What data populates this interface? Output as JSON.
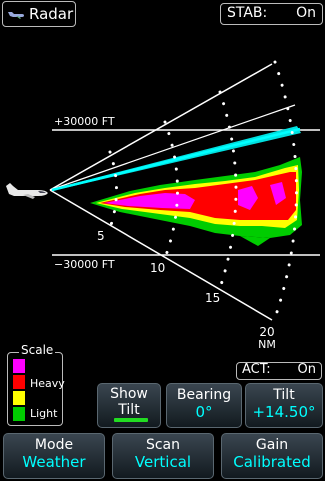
{
  "header": {
    "title": "Radar",
    "stab_label": "STAB:",
    "stab_value": "On"
  },
  "radar": {
    "alt_upper_label": "+30000 FT",
    "alt_lower_label": "−30000 FT",
    "range_labels": [
      "5",
      "10",
      "15",
      "20"
    ],
    "range_unit": "NM"
  },
  "scale": {
    "title": "Scale",
    "levels": [
      {
        "color": "#ff00ff",
        "label": ""
      },
      {
        "color": "#ff0000",
        "label": "Heavy"
      },
      {
        "color": "#ffff00",
        "label": ""
      },
      {
        "color": "#00cc00",
        "label": "Light"
      }
    ]
  },
  "act": {
    "label": "ACT:",
    "value": "On"
  },
  "buttons": {
    "show_tilt": {
      "line1": "Show",
      "line2": "Tilt"
    },
    "bearing": {
      "label": "Bearing",
      "value": "0°"
    },
    "tilt": {
      "label": "Tilt",
      "value": "+14.50°"
    },
    "mode": {
      "label": "Mode",
      "value": "Weather"
    },
    "scan": {
      "label": "Scan",
      "value": "Vertical"
    },
    "gain": {
      "label": "Gain",
      "value": "Calibrated"
    }
  }
}
